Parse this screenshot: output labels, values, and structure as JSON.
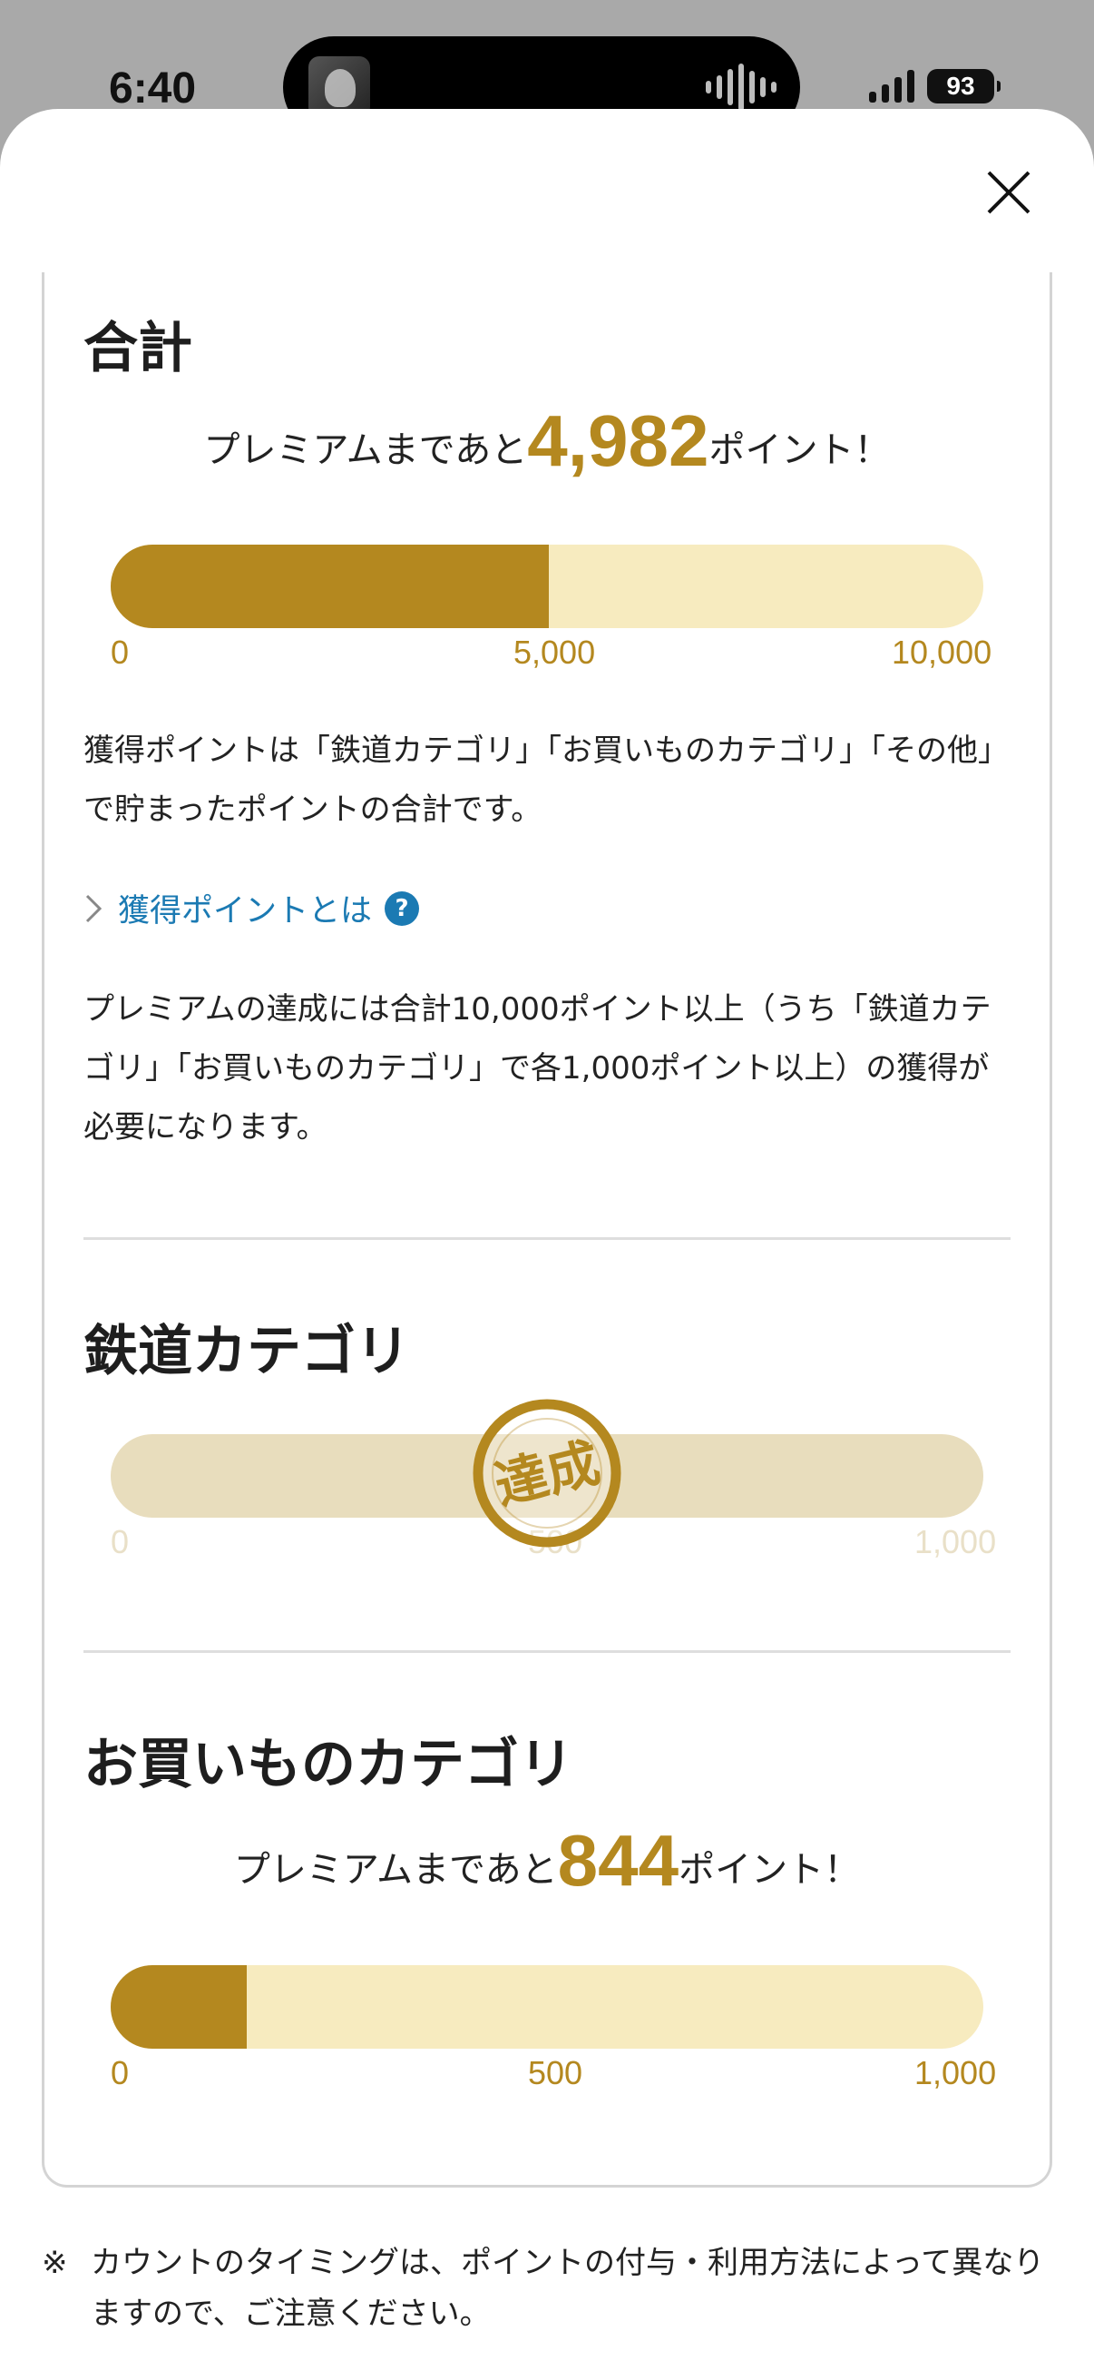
{
  "status": {
    "time": "6:40",
    "battery": "93"
  },
  "total": {
    "title": "合計",
    "remain_prefix": "プレミアムまであと",
    "remain_value": "4,982",
    "remain_suffix": "ポイント！",
    "progress_fraction": 0.5018,
    "ticks": [
      "0",
      "5,000",
      "10,000"
    ],
    "description": "獲得ポイントは「鉄道カテゴリ」「お買いものカテゴリ」「その他」で貯まったポイントの合計です。",
    "link_label": "獲得ポイントとは",
    "help_icon": "?",
    "requirement": "プレミアムの達成には合計10,000ポイント以上（うち「鉄道カテゴリ」「お買いものカテゴリ」で各1,000ポイント以上）の獲得が必要になります。"
  },
  "rail": {
    "title": "鉄道カテゴリ",
    "progress_fraction": 1.0,
    "ticks": [
      "0",
      "500",
      "1,000"
    ],
    "stamp": "達成"
  },
  "shopping": {
    "title": "お買いものカテゴリ",
    "remain_prefix": "プレミアムまであと",
    "remain_value": "844",
    "remain_suffix": "ポイント！",
    "progress_fraction": 0.156,
    "ticks": [
      "0",
      "500",
      "1,000"
    ]
  },
  "footnote": {
    "mark": "※",
    "text": "カウントのタイミングは、ポイントの付与・利用方法によって異なりますので、ご注意ください。"
  },
  "colors": {
    "accent": "#b4881f",
    "bar_track": "#f7ebbf",
    "link": "#1b7ab3"
  }
}
